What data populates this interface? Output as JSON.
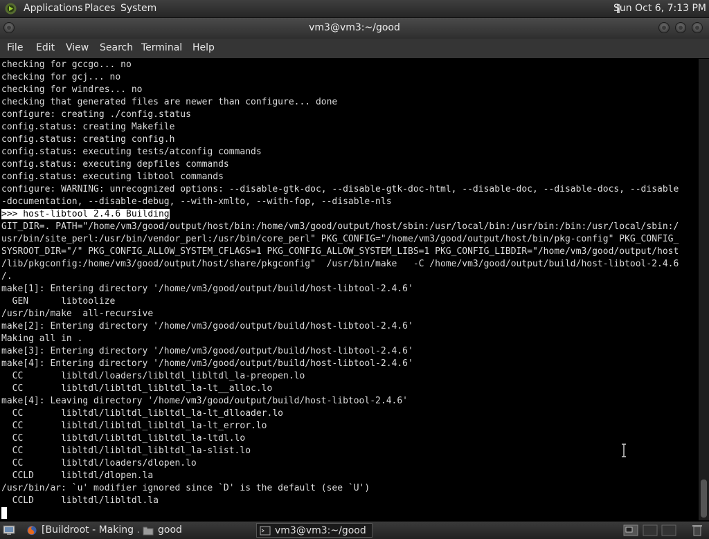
{
  "top_panel": {
    "menus": [
      "Applications",
      "Places",
      "System"
    ],
    "clock": "Sun Oct  6,  7:13 PM"
  },
  "window": {
    "title": "vm3@vm3:~/good"
  },
  "menubar": [
    "File",
    "Edit",
    "View",
    "Search",
    "Terminal",
    "Help"
  ],
  "terminal": {
    "lines_before": [
      "checking for gccgo... no",
      "checking for gcj... no",
      "checking for windres... no",
      "checking that generated files are newer than configure... done",
      "configure: creating ./config.status",
      "config.status: creating Makefile",
      "config.status: creating config.h",
      "config.status: executing tests/atconfig commands",
      "config.status: executing depfiles commands",
      "config.status: executing libtool commands",
      "configure: WARNING: unrecognized options: --disable-gtk-doc, --disable-gtk-doc-html, --disable-doc, --disable-docs, --disable",
      "-documentation, --disable-debug, --with-xmlto, --with-fop, --disable-nls"
    ],
    "highlight": ">>> host-libtool 2.4.6 Building",
    "lines_after": [
      "GIT_DIR=. PATH=\"/home/vm3/good/output/host/bin:/home/vm3/good/output/host/sbin:/usr/local/bin:/usr/bin:/bin:/usr/local/sbin:/",
      "usr/bin/site_perl:/usr/bin/vendor_perl:/usr/bin/core_perl\" PKG_CONFIG=\"/home/vm3/good/output/host/bin/pkg-config\" PKG_CONFIG_",
      "SYSROOT_DIR=\"/\" PKG_CONFIG_ALLOW_SYSTEM_CFLAGS=1 PKG_CONFIG_ALLOW_SYSTEM_LIBS=1 PKG_CONFIG_LIBDIR=\"/home/vm3/good/output/host",
      "/lib/pkgconfig:/home/vm3/good/output/host/share/pkgconfig\"  /usr/bin/make   -C /home/vm3/good/output/build/host-libtool-2.4.6",
      "/.",
      "make[1]: Entering directory '/home/vm3/good/output/build/host-libtool-2.4.6'",
      "  GEN      libtoolize",
      "/usr/bin/make  all-recursive",
      "make[2]: Entering directory '/home/vm3/good/output/build/host-libtool-2.4.6'",
      "Making all in .",
      "make[3]: Entering directory '/home/vm3/good/output/build/host-libtool-2.4.6'",
      "make[4]: Entering directory '/home/vm3/good/output/build/host-libtool-2.4.6'",
      "  CC       libltdl/loaders/libltdl_libltdl_la-preopen.lo",
      "  CC       libltdl/libltdl_libltdl_la-lt__alloc.lo",
      "make[4]: Leaving directory '/home/vm3/good/output/build/host-libtool-2.4.6'",
      "  CC       libltdl/libltdl_libltdl_la-lt_dlloader.lo",
      "  CC       libltdl/libltdl_libltdl_la-lt_error.lo",
      "  CC       libltdl/libltdl_libltdl_la-ltdl.lo",
      "  CC       libltdl/libltdl_libltdl_la-slist.lo",
      "  CC       libltdl/loaders/dlopen.lo",
      "  CCLD     libltdl/dlopen.la",
      "/usr/bin/ar: `u' modifier ignored since `D' is the default (see `U')",
      "  CCLD     libltdl/libltdl.la"
    ]
  },
  "taskbar": [
    {
      "label": "[Buildroot - Making ...",
      "icon": "firefox-icon",
      "active": false
    },
    {
      "label": "good",
      "icon": "folder-icon",
      "active": false
    },
    {
      "label": "vm3@vm3:~/good",
      "icon": "terminal-icon",
      "active": true
    }
  ],
  "colors": {
    "panel": "#2e2e2e",
    "terminal_bg": "#000000",
    "terminal_fg": "#dcdcdc"
  }
}
